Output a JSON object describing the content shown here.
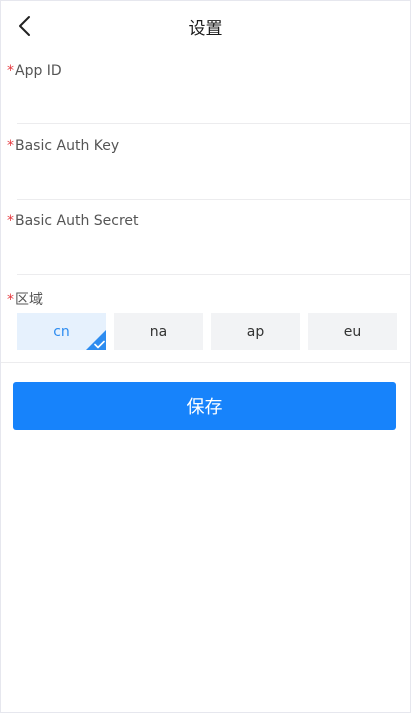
{
  "header": {
    "title": "设置",
    "back_icon": "chevron-left-icon"
  },
  "form": {
    "required_mark": "*",
    "app_id": {
      "label": "App ID",
      "value": ""
    },
    "basic_auth_key": {
      "label": "Basic Auth Key",
      "value": ""
    },
    "basic_auth_secret": {
      "label": "Basic Auth Secret",
      "value": ""
    },
    "region": {
      "label": "区域",
      "options": [
        "cn",
        "na",
        "ap",
        "eu"
      ],
      "selected": "cn"
    }
  },
  "actions": {
    "save_label": "保存"
  },
  "colors": {
    "accent": "#1783fb",
    "selected": "#2d8cf0",
    "required": "#e5383e"
  }
}
